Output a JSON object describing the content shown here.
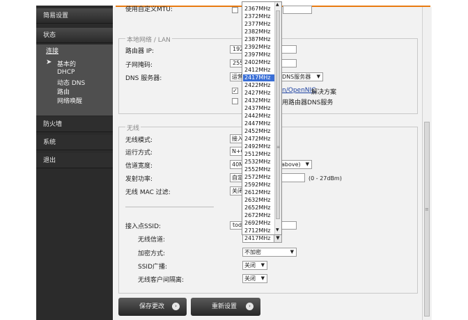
{
  "sidebar": {
    "items": [
      {
        "label": "简易设置"
      },
      {
        "label": "状态"
      },
      {
        "label": "防火墙"
      },
      {
        "label": "系统"
      },
      {
        "label": "退出"
      }
    ],
    "sub_header": "连接",
    "sub_active": "基本的",
    "sub_items": [
      "DHCP",
      "动态 DNS",
      "路由",
      "网络唤醒"
    ]
  },
  "top_row": {
    "label_partial": "使用自定义MTU:"
  },
  "lan": {
    "legend": "本地网络 / LAN",
    "router_ip_label": "路由器 IP:",
    "router_ip_value": "192",
    "subnet_label": "子网掩码:",
    "subnet_value": "255",
    "dns_label": "DNS 服务器:",
    "dns_select_left": "运营",
    "dns_select_right": "DNS服务器",
    "opennic_link": "n/OpenNIC",
    "opennic_suffix": " 解决方案",
    "router_dns_text": "用路由器DNS服务"
  },
  "wireless": {
    "legend": "无线",
    "mode_label": "无线模式:",
    "mode_value": "接入",
    "op_label": "运行方式:",
    "op_value": "N+G",
    "width_label": "信道宽度:",
    "width_value_left": "40M",
    "width_value_right": "above)",
    "power_label": "发射功率:",
    "power_value": "自定",
    "power_range": "(0 - 27dBm)",
    "mac_label": "无线 MAC 过滤:",
    "mac_value": "关闭",
    "ssid_label": "接入点SSID:",
    "ssid_value": "toda",
    "channel_label": "无线信道:",
    "channel_value": "2417MHz",
    "encrypt_label": "加密方式:",
    "encrypt_value": "不加密",
    "broadcast_label": "SSID广播:",
    "broadcast_value": "关闭",
    "isolation_label": "无线客户间隔离:",
    "isolation_value": "关闭"
  },
  "channel_options": [
    "2367MHz",
    "2372MHz",
    "2377MHz",
    "2382MHz",
    "2387MHz",
    "2392MHz",
    "2397MHz",
    "2402MHz",
    "2412MHz",
    "2417MHz",
    "2422MHz",
    "2427MHz",
    "2432MHz",
    "2437MHz",
    "2442MHz",
    "2447MHz",
    "2452MHz",
    "2472MHz",
    "2492MHz",
    "2512MHz",
    "2532MHz",
    "2552MHz",
    "2572MHz",
    "2592MHz",
    "2612MHz",
    "2632MHz",
    "2652MHz",
    "2672MHz",
    "2692MHz",
    "2712MHz"
  ],
  "channel_selected": "2417MHz",
  "buttons": {
    "save": "保存更改",
    "reset": "重新设置"
  },
  "check_mark": "✓",
  "colors": {
    "accent": "#e87a10",
    "selection": "#3a6fd6",
    "sidebar": "#2b2b2b"
  }
}
